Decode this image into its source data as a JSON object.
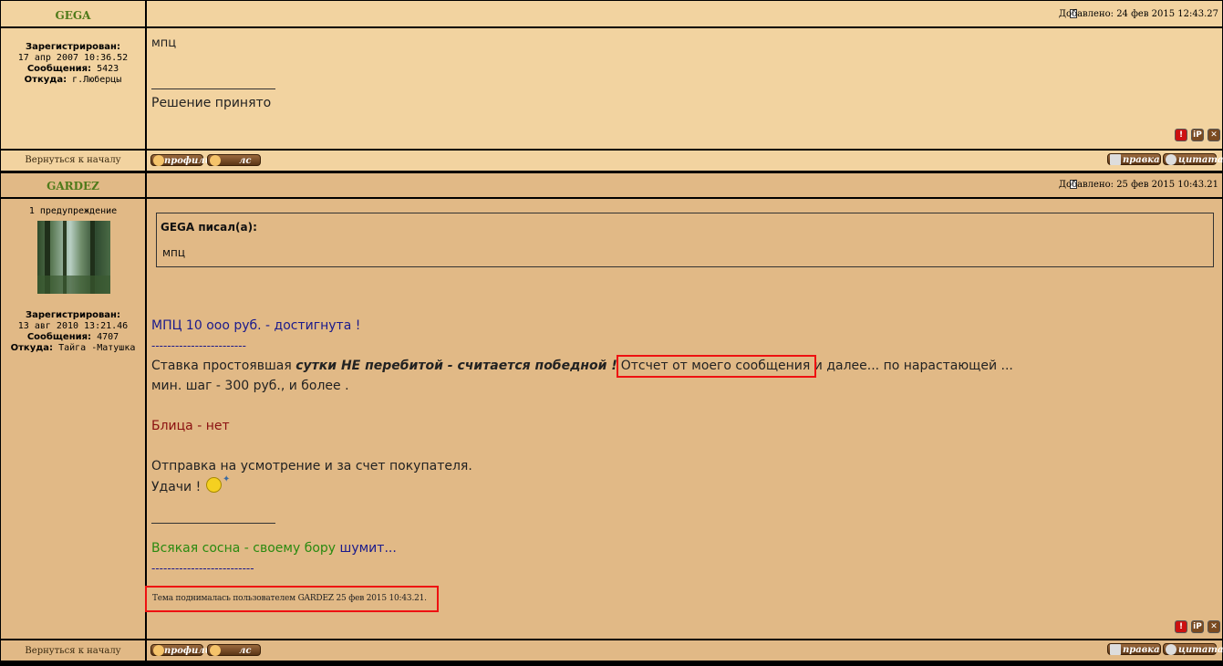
{
  "post1": {
    "author": "GEGA",
    "added": "Добавлено: 24 фев 2015 12:43.27",
    "registered_label": "Зарегистрирован:",
    "registered_value": "17 апр 2007 10:36.52",
    "messages_label": "Сообщения:",
    "messages_value": "5423",
    "from_label": "Откуда:",
    "from_value": "г.Люберцы",
    "body_text": "мпц",
    "signature": "Решение принято",
    "back_link": "Вернуться к началу",
    "profile_btn": "профиль",
    "pm_btn": "лс",
    "edit_btn": "правка",
    "quote_btn": "цитата"
  },
  "post2": {
    "author": "GARDEZ",
    "added": "Добавлено: 25 фев 2015 10:43.21",
    "warning": "1 предупреждение",
    "registered_label": "Зарегистрирован:",
    "registered_value": "13 авг 2010 13:21.46",
    "messages_label": "Сообщения:",
    "messages_value": "4707",
    "from_label": "Откуда:",
    "from_value": "Тайга -Матушка",
    "quote_author": "GEGA писал(а):",
    "quote_text": "мпц",
    "line1": "МПЦ 10 ооо руб. - достигнута !",
    "dashes1": "------------------------",
    "line2_start": "Ставка простоявшая ",
    "line2_bold": "сутки НЕ перебитой - считается победной !",
    "line2_boxed": "Отсчет от моего сообщения",
    "line2_end": " и далее... по нарастающей ...",
    "line3": "мин. шаг - 300 руб., и более .",
    "line4": "Блица - нет",
    "line5": "Отправка на усмотрение и за счет покупателя.",
    "line6": "Удачи !",
    "sig_green": "Всякая сосна - своему бору",
    "sig_rest": " шумит...",
    "dashes2": "--------------------------",
    "bump_notice": "Тема поднималась пользователем GARDEZ 25 фев 2015 10:43.21.",
    "back_link": "Вернуться к началу",
    "profile_btn": "профиль",
    "pm_btn": "лс",
    "edit_btn": "правка",
    "quote_btn": "цитата"
  },
  "icons": {
    "report": "report-icon",
    "ip": "ip-icon",
    "delete": "delete-icon",
    "post": "post-icon",
    "smiley": "smiley-icon"
  },
  "colors": {
    "nick": "#4f7a1a",
    "bg_light": "#f2d3a0",
    "bg_dark": "#e1b986",
    "link_blue": "#1a1a8c",
    "red_text": "#8b1010",
    "green_text": "#2a8a10",
    "highlight": "#e11111"
  }
}
